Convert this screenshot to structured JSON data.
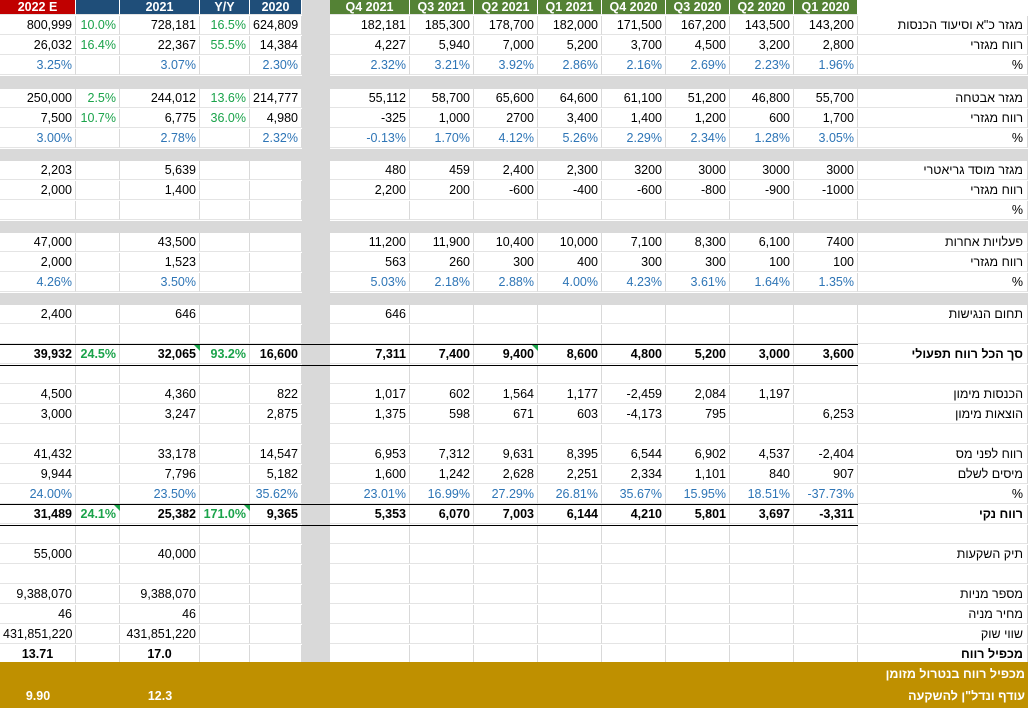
{
  "colors": {
    "header_red": "#c00000",
    "header_blue": "#1f4e79",
    "header_green": "#548235",
    "pct_blue": "#2e75b6",
    "yoy_green": "#1aa34a",
    "footer_gold": "#bf9000",
    "separator_gray": "#d9d9d9"
  },
  "headers": {
    "left": [
      "2022 E",
      "",
      "2021",
      "Y/Y",
      "2020"
    ],
    "quarters": [
      "Q4 2021",
      "Q3 2021",
      "Q2 2021",
      "Q1 2021",
      "Q4 2020",
      "Q3 2020",
      "Q2 2020",
      "Q1 2020"
    ]
  },
  "rows": [
    {
      "label": "מגזר כ\"א וסיעוד הכנסות",
      "cells": [
        "800,999",
        "10.0%",
        "728,181",
        "16.5%",
        "624,809",
        "182,181",
        "185,300",
        "178,700",
        "182,000",
        "171,500",
        "167,200",
        "143,500",
        "143,200"
      ]
    },
    {
      "label": "רווח מגזרי",
      "cells": [
        "26,032",
        "16.4%",
        "22,367",
        "55.5%",
        "14,384",
        "4,227",
        "5,940",
        "7,000",
        "5,200",
        "3,700",
        "4,500",
        "3,200",
        "2,800"
      ]
    },
    {
      "label": "%",
      "cells": [
        "3.25%",
        "",
        "3.07%",
        "",
        "2.30%",
        "2.32%",
        "3.21%",
        "3.92%",
        "2.86%",
        "2.16%",
        "2.69%",
        "2.23%",
        "1.96%"
      ]
    },
    {
      "label": "מגזר אבטחה",
      "cells": [
        "250,000",
        "2.5%",
        "244,012",
        "13.6%",
        "214,777",
        "55,112",
        "58,700",
        "65,600",
        "64,600",
        "61,100",
        "51,200",
        "46,800",
        "55,700"
      ]
    },
    {
      "label": "רווח מגזרי",
      "cells": [
        "7,500",
        "10.7%",
        "6,775",
        "36.0%",
        "4,980",
        "-325",
        "1,000",
        "2700",
        "3,400",
        "1,400",
        "1,200",
        "600",
        "1,700"
      ]
    },
    {
      "label": "%",
      "cells": [
        "3.00%",
        "",
        "2.78%",
        "",
        "2.32%",
        "-0.13%",
        "1.70%",
        "4.12%",
        "5.26%",
        "2.29%",
        "2.34%",
        "1.28%",
        "3.05%"
      ]
    },
    {
      "label": "מגזר מוסד גריאטרי",
      "cells": [
        "2,203",
        "",
        "5,639",
        "",
        "",
        "480",
        "459",
        "2,400",
        "2,300",
        "3200",
        "3000",
        "3000",
        "3000"
      ]
    },
    {
      "label": "רווח מגזרי",
      "cells": [
        "2,000",
        "",
        "1,400",
        "",
        "",
        "2,200",
        "200",
        "-600",
        "-400",
        "-600",
        "-800",
        "-900",
        "-1000"
      ]
    },
    {
      "label": "%",
      "cells": [
        "",
        "",
        "",
        "",
        "",
        "",
        "",
        "",
        "",
        "",
        "",
        "",
        ""
      ]
    },
    {
      "label": "פעלויות אחרות",
      "cells": [
        "47,000",
        "",
        "43,500",
        "",
        "",
        "11,200",
        "11,900",
        "10,400",
        "10,000",
        "7,100",
        "8,300",
        "6,100",
        "7400"
      ]
    },
    {
      "label": "רווח מגזרי",
      "cells": [
        "2,000",
        "",
        "1,523",
        "",
        "",
        "563",
        "260",
        "300",
        "400",
        "300",
        "300",
        "100",
        "100"
      ]
    },
    {
      "label": "%",
      "cells": [
        "4.26%",
        "",
        "3.50%",
        "",
        "",
        "5.03%",
        "2.18%",
        "2.88%",
        "4.00%",
        "4.23%",
        "3.61%",
        "1.64%",
        "1.35%"
      ]
    },
    {
      "label": "תחום הנגישות",
      "cells": [
        "2,400",
        "",
        "646",
        "",
        "",
        "646",
        "",
        "",
        "",
        "",
        "",
        "",
        ""
      ]
    },
    {
      "label": "",
      "cells": [
        "",
        "",
        "",
        "",
        "",
        "",
        "",
        "",
        "",
        "",
        "",
        "",
        ""
      ]
    },
    {
      "label": "סך הכל רווח תפעולי",
      "cells": [
        "39,932",
        "24.5%",
        "32,065",
        "93.2%",
        "16,600",
        "7,311",
        "7,400",
        "9,400",
        "8,600",
        "4,800",
        "5,200",
        "3,000",
        "3,600"
      ]
    },
    {
      "label": "",
      "cells": [
        "",
        "",
        "",
        "",
        "",
        "",
        "",
        "",
        "",
        "",
        "",
        "",
        ""
      ]
    },
    {
      "label": "הכנסות מימון",
      "cells": [
        "4,500",
        "",
        "4,360",
        "",
        "822",
        "1,017",
        "602",
        "1,564",
        "1,177",
        "-2,459",
        "2,084",
        "1,197",
        ""
      ]
    },
    {
      "label": "הוצאות מימון",
      "cells": [
        "3,000",
        "",
        "3,247",
        "",
        "2,875",
        "1,375",
        "598",
        "671",
        "603",
        "-4,173",
        "795",
        "",
        "6,253"
      ]
    },
    {
      "label": "",
      "cells": [
        "",
        "",
        "",
        "",
        "",
        "",
        "",
        "",
        "",
        "",
        "",
        "",
        ""
      ]
    },
    {
      "label": "רווח לפני מס",
      "cells": [
        "41,432",
        "",
        "33,178",
        "",
        "14,547",
        "6,953",
        "7,312",
        "9,631",
        "8,395",
        "6,544",
        "6,902",
        "4,537",
        "-2,404"
      ]
    },
    {
      "label": "מיסים לשלם",
      "cells": [
        "9,944",
        "",
        "7,796",
        "",
        "5,182",
        "1,600",
        "1,242",
        "2,628",
        "2,251",
        "2,334",
        "1,101",
        "840",
        "907"
      ]
    },
    {
      "label": "%",
      "cells": [
        "24.00%",
        "",
        "23.50%",
        "",
        "35.62%",
        "23.01%",
        "16.99%",
        "27.29%",
        "26.81%",
        "35.67%",
        "15.95%",
        "18.51%",
        "-37.73%"
      ]
    },
    {
      "label": "רווח נקי",
      "cells": [
        "31,489",
        "24.1%",
        "25,382",
        "171.0%",
        "9,365",
        "5,353",
        "6,070",
        "7,003",
        "6,144",
        "4,210",
        "5,801",
        "3,697",
        "-3,311"
      ]
    },
    {
      "label": "",
      "cells": [
        "",
        "",
        "",
        "",
        "",
        "",
        "",
        "",
        "",
        "",
        "",
        "",
        ""
      ]
    },
    {
      "label": "תיק השקעות",
      "cells": [
        "55,000",
        "",
        "40,000",
        "",
        "",
        "",
        "",
        "",
        "",
        "",
        "",
        "",
        ""
      ]
    },
    {
      "label": "",
      "cells": [
        "",
        "",
        "",
        "",
        "",
        "",
        "",
        "",
        "",
        "",
        "",
        "",
        ""
      ]
    },
    {
      "label": "מספר מניות",
      "cells": [
        "9,388,070",
        "",
        "9,388,070",
        "",
        "",
        "",
        "",
        "",
        "",
        "",
        "",
        "",
        ""
      ]
    },
    {
      "label": "מחיר מניה",
      "cells": [
        "46",
        "",
        "46",
        "",
        "",
        "",
        "",
        "",
        "",
        "",
        "",
        "",
        ""
      ]
    },
    {
      "label": "שווי שוק",
      "cells": [
        "431,851,220",
        "",
        "431,851,220",
        "",
        "",
        "",
        "",
        "",
        "",
        "",
        "",
        "",
        ""
      ]
    },
    {
      "label": "מכפיל רווח",
      "cells": [
        "13.71",
        "",
        "17.0",
        "",
        "",
        "",
        "",
        "",
        "",
        "",
        "",
        "",
        ""
      ]
    }
  ],
  "footer": {
    "line1": "מכפיל רווח בנטרול מזומן",
    "line2": "עודף ונדל\"ן להשקעה",
    "val_2022": "9.90",
    "val_2021": "12.3"
  }
}
